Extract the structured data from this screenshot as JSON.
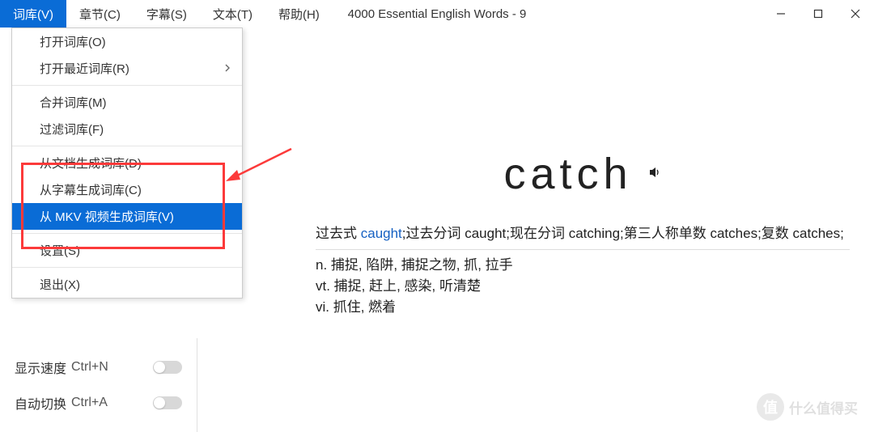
{
  "window": {
    "title": "4000 Essential English Words - 9"
  },
  "menubar": {
    "items": [
      {
        "label": "词库(V)",
        "active": true
      },
      {
        "label": "章节(C)",
        "active": false
      },
      {
        "label": "字幕(S)",
        "active": false
      },
      {
        "label": "文本(T)",
        "active": false
      },
      {
        "label": "帮助(H)",
        "active": false
      }
    ]
  },
  "dropdown": {
    "groups": [
      [
        {
          "label": "打开词库(O)",
          "submenu": false,
          "highlighted": false
        },
        {
          "label": "打开最近词库(R)",
          "submenu": true,
          "highlighted": false
        }
      ],
      [
        {
          "label": "合并词库(M)",
          "submenu": false,
          "highlighted": false
        },
        {
          "label": "过滤词库(F)",
          "submenu": false,
          "highlighted": false
        }
      ],
      [
        {
          "label": "从文档生成词库(D)",
          "submenu": false,
          "highlighted": false
        },
        {
          "label": "从字幕生成词库(C)",
          "submenu": false,
          "highlighted": false
        },
        {
          "label": "从 MKV 视频生成词库(V)",
          "submenu": false,
          "highlighted": true
        }
      ],
      [
        {
          "label": "设置(S)",
          "submenu": false,
          "highlighted": false
        }
      ],
      [
        {
          "label": "退出(X)",
          "submenu": false,
          "highlighted": false
        }
      ]
    ]
  },
  "word": {
    "main": "catch",
    "forms_prefix": "过去式 ",
    "forms_link": "caught",
    "forms_rest": ";过去分词 caught;现在分词 catching;第三人称单数 catches;复数 catches;",
    "defs": [
      "n. 捕捉, 陷阱, 捕捉之物, 抓, 拉手",
      "vt. 捕捉, 赶上, 感染, 听清楚",
      "vi. 抓住, 燃着"
    ]
  },
  "sidebar": {
    "controls": [
      {
        "label": "显示速度",
        "shortcut": "Ctrl+N"
      },
      {
        "label": "自动切换",
        "shortcut": "Ctrl+A"
      }
    ]
  },
  "watermark": {
    "badge": "值",
    "text": "什么值得买"
  }
}
